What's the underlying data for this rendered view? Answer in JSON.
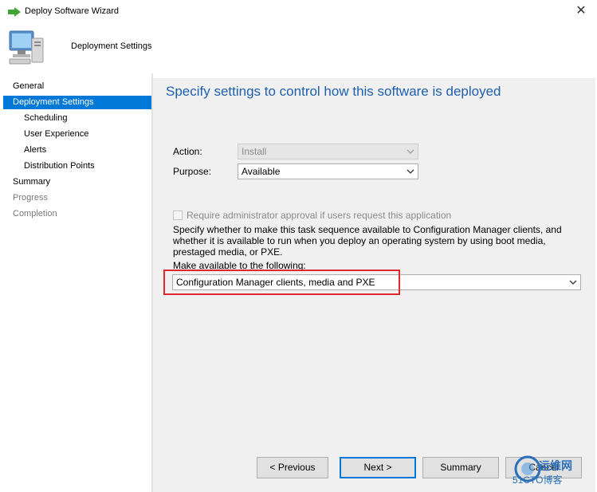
{
  "window": {
    "title": "Deploy Software Wizard",
    "close_glyph": "✕"
  },
  "header": {
    "title": "Deployment Settings",
    "icon": "computer-icon"
  },
  "nav": {
    "items": [
      {
        "label": "General",
        "state": "normal",
        "level": 0
      },
      {
        "label": "Deployment Settings",
        "state": "active",
        "level": 0
      },
      {
        "label": "Scheduling",
        "state": "normal",
        "level": 1
      },
      {
        "label": "User Experience",
        "state": "normal",
        "level": 1
      },
      {
        "label": "Alerts",
        "state": "normal",
        "level": 1
      },
      {
        "label": "Distribution Points",
        "state": "normal",
        "level": 1
      },
      {
        "label": "Summary",
        "state": "normal",
        "level": 0
      },
      {
        "label": "Progress",
        "state": "disabled",
        "level": 0
      },
      {
        "label": "Completion",
        "state": "disabled",
        "level": 0
      }
    ]
  },
  "main": {
    "heading": "Specify settings to control how this software is deployed",
    "action_label": "Action:",
    "action_value": "Install",
    "purpose_label": "Purpose:",
    "purpose_value": "Available",
    "approval_checkbox_label": "Require administrator approval if users request this application",
    "approval_checked": false,
    "description": "Specify whether to make this task sequence available to Configuration Manager clients, and whether it is available to run when you deploy an operating system by using boot media, prestaged media, or PXE.",
    "make_available_label": "Make available to the following:",
    "make_available_value": "Configuration Manager clients, media and PXE"
  },
  "buttons": {
    "previous": "< Previous",
    "next": "Next >",
    "summary": "Summary",
    "cancel": "Cancel"
  },
  "watermark": {
    "line1": "运维网",
    "line2": "51CTO博客"
  },
  "colors": {
    "accent": "#0078d7",
    "heading": "#1e5fae",
    "highlight": "#e0282c"
  }
}
